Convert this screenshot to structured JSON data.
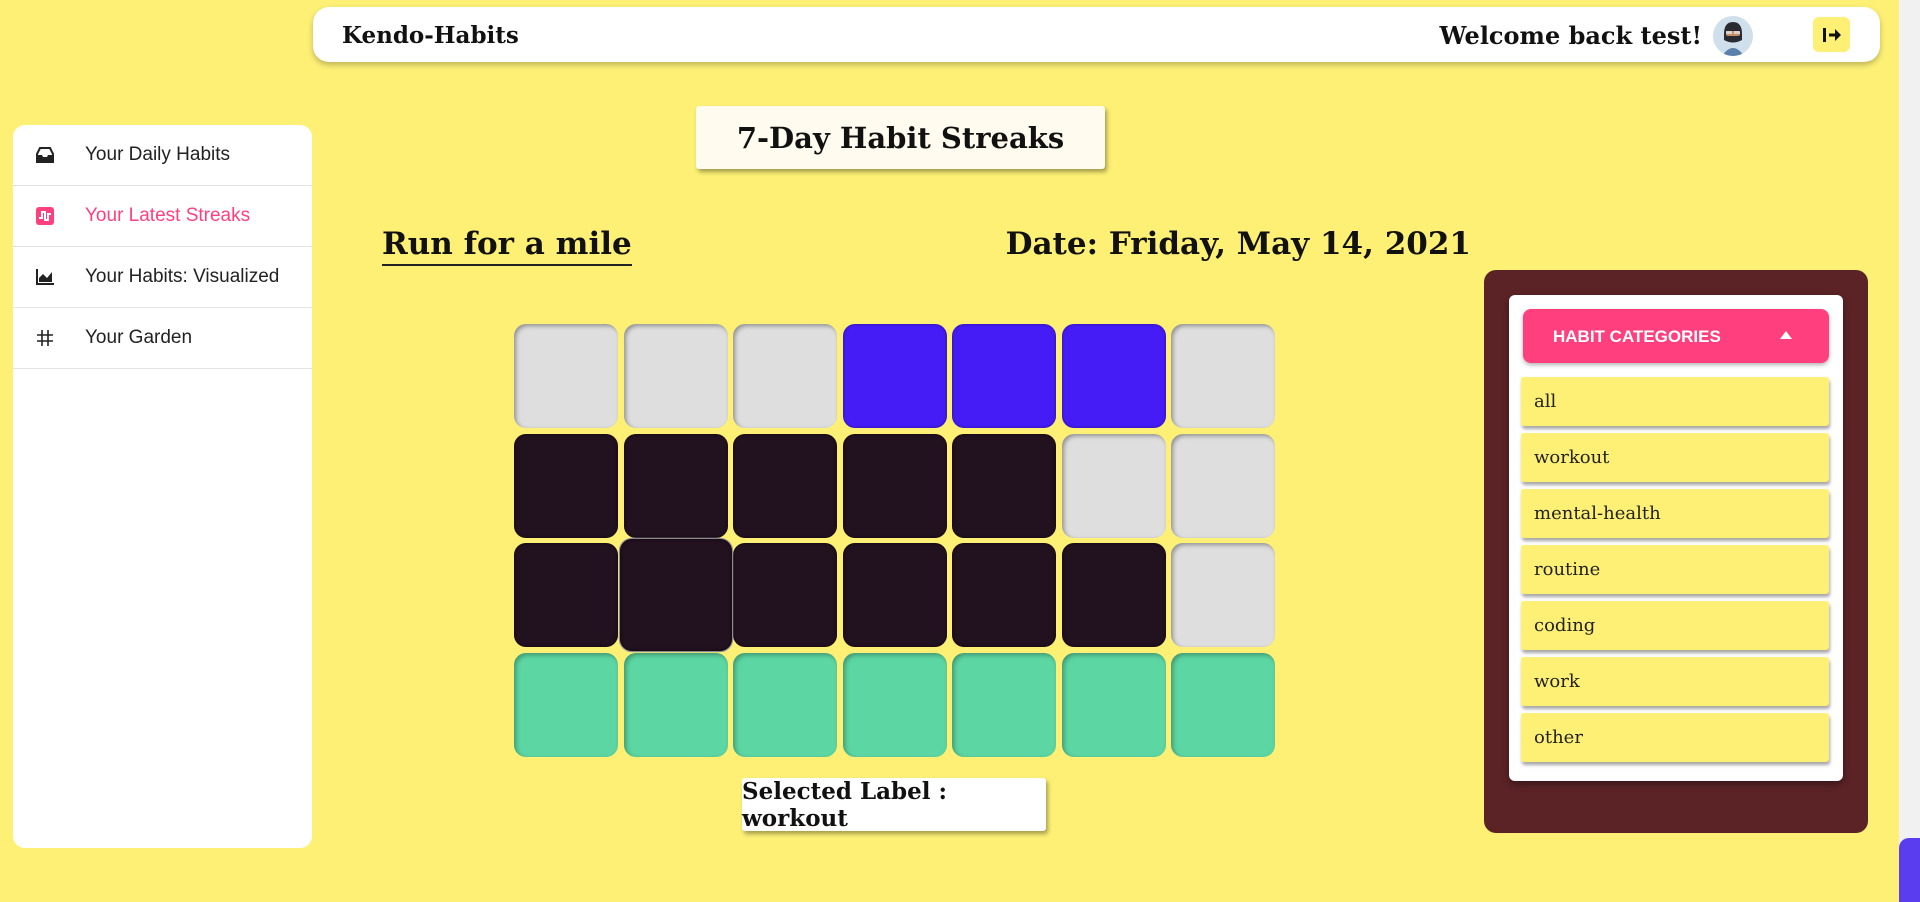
{
  "app": {
    "title": "Kendo-Habits",
    "welcome": "Welcome back test!"
  },
  "sidebar": {
    "items": [
      {
        "label": "Your Daily Habits",
        "icon": "inbox-icon",
        "active": false
      },
      {
        "label": "Your Latest Streaks",
        "icon": "streak-icon",
        "active": true
      },
      {
        "label": "Your Habits: Visualized",
        "icon": "chart-icon",
        "active": false
      },
      {
        "label": "Your Garden",
        "icon": "grid-icon",
        "active": false
      }
    ]
  },
  "main": {
    "title": "7-Day Habit Streaks",
    "habit_name": "Run for a mile",
    "date": "Date: Friday, May 14, 2021",
    "selected_label": "Selected Label : workout",
    "grid": {
      "rows": [
        [
          "gray",
          "gray",
          "gray",
          "blue",
          "blue",
          "blue",
          "gray"
        ],
        [
          "dark",
          "dark",
          "dark",
          "dark",
          "dark",
          "gray",
          "gray"
        ],
        [
          "dark",
          "dark",
          "dark",
          "dark",
          "dark",
          "dark",
          "gray"
        ],
        [
          "green",
          "green",
          "green",
          "green",
          "green",
          "green",
          "green"
        ]
      ],
      "hovered": [
        2,
        1
      ]
    }
  },
  "categories": {
    "header": "HABIT CATEGORIES",
    "items": [
      "all",
      "workout",
      "mental-health",
      "routine",
      "coding",
      "work",
      "other"
    ]
  },
  "colors": {
    "background": "#fdf075",
    "accent": "#ff3f7e",
    "blue": "#451cf6",
    "dark": "#22111f",
    "green": "#5cd6a2",
    "gray": "#dedede",
    "panel": "#5c2326"
  }
}
